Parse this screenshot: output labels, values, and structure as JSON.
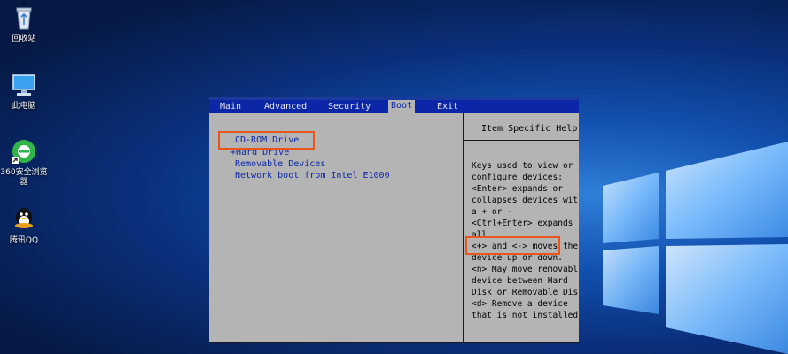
{
  "desktop": {
    "icons": [
      {
        "label": "回收站",
        "icon": "recycle-bin-icon"
      },
      {
        "label": "此电脑",
        "icon": "computer-icon"
      },
      {
        "label": "360安全浏览\n器",
        "icon": "browser-360-icon"
      },
      {
        "label": "腾讯QQ",
        "icon": "qq-icon"
      }
    ]
  },
  "bios": {
    "menu": [
      "Main",
      "Advanced",
      "Security",
      "Boot",
      "Exit"
    ],
    "active_menu": "Boot",
    "boot_order": [
      "CD-ROM Drive",
      "+Hard Drive",
      "Removable Devices",
      "Network boot from Intel E1000"
    ],
    "help_title": "Item Specific Help",
    "help_lines": [
      "Keys used to view or",
      "configure devices:",
      "<Enter> expands or",
      "collapses devices with",
      "a + or -",
      "<Ctrl+Enter> expands",
      "all",
      "<+> and <-> moves the",
      "device up or down.",
      "<n> May move removable",
      "device between Hard",
      "Disk or Removable Disk",
      "<d> Remove a device",
      "that is not installed."
    ]
  },
  "colors": {
    "menu_bar": "#0b27a8",
    "panel": "#b4b4b4",
    "highlight": "#e8561c"
  }
}
